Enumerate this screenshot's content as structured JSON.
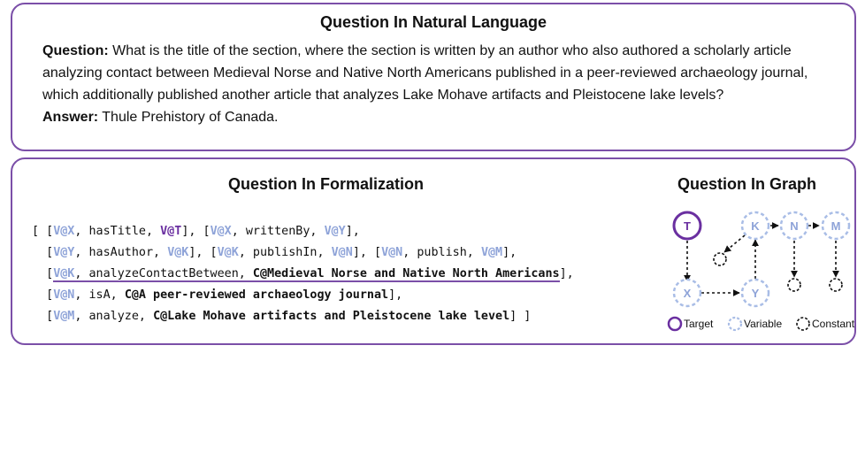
{
  "natural_language": {
    "title": "Question In Natural Language",
    "question_label": "Question:",
    "question_text": "What is the title of the section, where the section is written by an author who also authored a scholarly article analyzing contact between Medieval Norse and Native North Americans published in a peer-reviewed archaeology journal, which additionally published another article that analyzes Lake Mohave artifacts and Pleistocene lake levels?",
    "answer_label": "Answer:",
    "answer_text": "Thule Prehistory of Canada."
  },
  "formalization": {
    "title": "Question In Formalization",
    "lines": [
      [
        {
          "t": "[ [",
          "s": "plain"
        },
        {
          "t": "V@X",
          "s": "var"
        },
        {
          "t": ", hasTitle, ",
          "s": "plain"
        },
        {
          "t": "V@T",
          "s": "target"
        },
        {
          "t": "], [",
          "s": "plain"
        },
        {
          "t": "V@X",
          "s": "var"
        },
        {
          "t": ", writtenBy, ",
          "s": "plain"
        },
        {
          "t": "V@Y",
          "s": "var"
        },
        {
          "t": "],",
          "s": "plain"
        }
      ],
      [
        {
          "t": "  [",
          "s": "plain"
        },
        {
          "t": "V@Y",
          "s": "var"
        },
        {
          "t": ", hasAuthor, ",
          "s": "plain"
        },
        {
          "t": "V@K",
          "s": "var"
        },
        {
          "t": "], [",
          "s": "plain"
        },
        {
          "t": "V@K",
          "s": "var"
        },
        {
          "t": ", publishIn, ",
          "s": "plain"
        },
        {
          "t": "V@N",
          "s": "var"
        },
        {
          "t": "], [",
          "s": "plain"
        },
        {
          "t": "V@N",
          "s": "var"
        },
        {
          "t": ", publish, ",
          "s": "plain"
        },
        {
          "t": "V@M",
          "s": "var"
        },
        {
          "t": "],",
          "s": "plain"
        }
      ],
      [
        {
          "t": "  [",
          "s": "plain"
        },
        {
          "t": "V@K",
          "s": "var",
          "u": true
        },
        {
          "t": ", analyzeContactBetween, ",
          "s": "plain",
          "u": true
        },
        {
          "t": "C@Medieval Norse and Native North Americans",
          "s": "const",
          "u": true
        },
        {
          "t": "],",
          "s": "plain"
        }
      ],
      [
        {
          "t": "  [",
          "s": "plain"
        },
        {
          "t": "V@N",
          "s": "var"
        },
        {
          "t": ", isA, ",
          "s": "plain"
        },
        {
          "t": "C@A peer-reviewed archaeology journal",
          "s": "const"
        },
        {
          "t": "],",
          "s": "plain"
        }
      ],
      [
        {
          "t": "  [",
          "s": "plain"
        },
        {
          "t": "V@M",
          "s": "var"
        },
        {
          "t": ", analyze, ",
          "s": "plain"
        },
        {
          "t": "C@Lake Mohave artifacts and Pleistocene lake level",
          "s": "const"
        },
        {
          "t": "] ]",
          "s": "plain"
        }
      ]
    ]
  },
  "graph": {
    "title": "Question In Graph",
    "nodes": {
      "T": "T",
      "K": "K",
      "N": "N",
      "M": "M",
      "X": "X",
      "Y": "Y"
    },
    "legend": {
      "target": "Target",
      "variable": "Variable",
      "constant": "Constant"
    },
    "colors": {
      "target": "#6a2fa0",
      "variable": "#a9bde6",
      "constant": "#111111",
      "border": "#7b4fa8"
    }
  }
}
